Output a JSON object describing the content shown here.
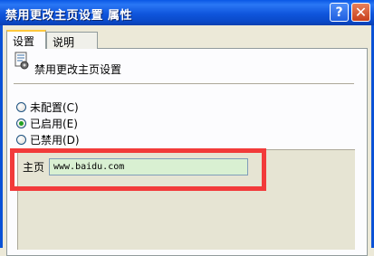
{
  "window": {
    "title": "禁用更改主页设置 属性",
    "help_glyph": "?",
    "close_glyph": "✕"
  },
  "tabs": [
    {
      "label": "设置",
      "active": true
    },
    {
      "label": "说明",
      "active": false
    }
  ],
  "policy": {
    "name": "禁用更改主页设置",
    "icon": "policy-setting-icon"
  },
  "options": [
    {
      "label": "未配置(C)",
      "selected": false
    },
    {
      "label": "已启用(E)",
      "selected": true
    },
    {
      "label": "已禁用(D)",
      "selected": false
    }
  ],
  "homepage": {
    "label": "主页",
    "value": "www.baidu.com"
  },
  "colors": {
    "title_bar": "#0a58e6",
    "highlight": "#f23a3a",
    "input_bg": "#d9f0d2",
    "selected_radio": "#21a121"
  }
}
